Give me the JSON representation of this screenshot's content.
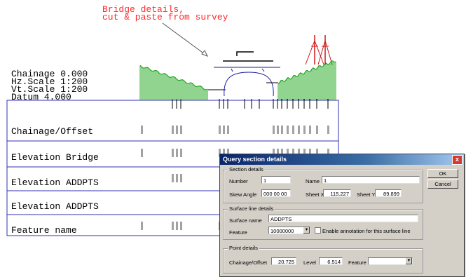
{
  "annotation": {
    "line1": "Bridge details,",
    "line2": "cut & paste from survey"
  },
  "section_info": {
    "chainage": "Chainage 0.000",
    "hz_scale": "Hz.Scale 1:200",
    "vt_scale": "Vt.Scale 1:200",
    "datum": "Datum 4.000"
  },
  "table_rows": [
    "Chainage/Offset",
    "Elevation Bridge",
    "Elevation ADDPTS",
    "Elevation ADDPTS",
    "Feature name"
  ],
  "dialog": {
    "title": "Query section details",
    "close_glyph": "x",
    "ok_label": "OK",
    "cancel_label": "Cancel",
    "section_details": {
      "group_label": "Section details",
      "number_label": "Number",
      "number_value": "1",
      "name_label": "Name",
      "name_value": "1",
      "skew_label": "Skew Angle",
      "skew_value": "000 00 00",
      "sheetx_label": "Sheet X",
      "sheetx_value": "115.227",
      "sheety_label": "Sheet Y",
      "sheety_value": "89.899"
    },
    "surface_details": {
      "group_label": "Surface line details",
      "surface_name_label": "Surface name",
      "surface_name_value": "ADDPTS",
      "feature_label": "Feature",
      "feature_value": "10000000",
      "annotation_label": "Enable annotation for this surface line"
    },
    "point_details": {
      "group_label": "Point details",
      "chainage_label": "Chainage/Offset",
      "chainage_value": "20.725",
      "level_label": "Level",
      "level_value": "6.514",
      "feature_label": "Feature",
      "feature_value": ""
    }
  },
  "colors": {
    "ground": "#22a822",
    "table_border": "#3030b0",
    "annotation": "#ff2b2b",
    "towers": "#d01818",
    "bridge": "#1a1aa0"
  }
}
